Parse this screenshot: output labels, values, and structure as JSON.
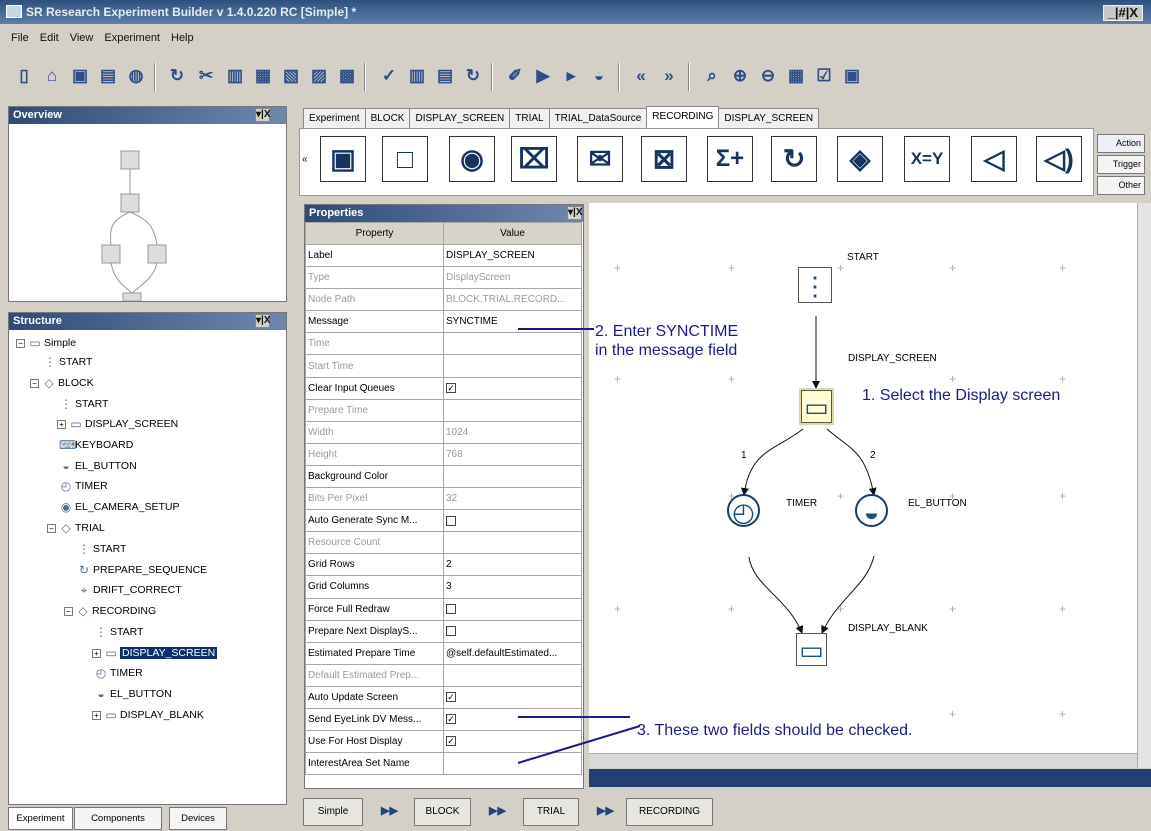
{
  "window": {
    "title": "SR Research Experiment Builder v 1.4.0.220 RC [Simple] *",
    "controls": "_|#|X"
  },
  "menu": [
    "File",
    "Edit",
    "View",
    "Experiment",
    "Help"
  ],
  "toolbar_icons": [
    "new-file-icon",
    "open-folder-icon",
    "save-icon",
    "print-icon",
    "cube-icon",
    "redo-icon",
    "cut-icon",
    "copy-icon",
    "paste-icon",
    "delete-icon",
    "clear-icon",
    "grid-icon",
    "check-icon",
    "chart-icon",
    "note-icon",
    "refresh-icon",
    "brush-icon",
    "run-icon",
    "play-icon",
    "hat-icon",
    "rewind-icon",
    "forward-icon",
    "search-icon",
    "zoom-in-icon",
    "zoom-out-icon",
    "layout-icon",
    "checkbox-icon",
    "settings-icon"
  ],
  "overview": {
    "title": "Overview",
    "controls": "▾|X"
  },
  "structure": {
    "title": "Structure",
    "controls": "▾|X",
    "root": "Simple",
    "items": [
      {
        "label": "START",
        "icon": "traffic-light-icon"
      },
      {
        "label": "BLOCK",
        "icon": "diamond-node-icon"
      },
      {
        "label": "START",
        "icon": "traffic-light-icon"
      },
      {
        "label": "DISPLAY_SCREEN",
        "icon": "monitor-icon"
      },
      {
        "label": "KEYBOARD",
        "icon": "keyboard-icon"
      },
      {
        "label": "EL_BUTTON",
        "icon": "gamepad-icon"
      },
      {
        "label": "TIMER",
        "icon": "timer-icon"
      },
      {
        "label": "EL_CAMERA_SETUP",
        "icon": "eye-camera-icon"
      },
      {
        "label": "TRIAL",
        "icon": "diamond-node-icon"
      },
      {
        "label": "START",
        "icon": "traffic-light-icon"
      },
      {
        "label": "PREPARE_SEQUENCE",
        "icon": "refresh-icon"
      },
      {
        "label": "DRIFT_CORRECT",
        "icon": "target-icon"
      },
      {
        "label": "RECORDING",
        "icon": "diamond-node-icon"
      },
      {
        "label": "START",
        "icon": "traffic-light-icon"
      },
      {
        "label": "DISPLAY_SCREEN",
        "icon": "monitor-icon"
      },
      {
        "label": "TIMER",
        "icon": "timer-icon"
      },
      {
        "label": "EL_BUTTON",
        "icon": "gamepad-icon"
      },
      {
        "label": "DISPLAY_BLANK",
        "icon": "monitor-icon"
      }
    ]
  },
  "editor_tabs": [
    "Experiment",
    "BLOCK",
    "DISPLAY_SCREEN",
    "TRIAL",
    "TRIAL_DataSource",
    "RECORDING",
    "DISPLAY_SCREEN"
  ],
  "palette": {
    "categories": [
      "Action",
      "Trigger",
      "Other"
    ],
    "items": [
      "display-screen-icon",
      "display-blank-icon",
      "eye-camera-icon",
      "mouse-icon",
      "send-message-icon",
      "error-message-icon",
      "sum-icon",
      "rotate-icon",
      "decision-icon",
      "assignment-icon",
      "sound-icon",
      "sound-volume-icon"
    ]
  },
  "properties": {
    "title": "Properties",
    "controls": "▾|X",
    "headers": {
      "property": "Property",
      "value": "Value"
    },
    "rows": [
      {
        "name": "Label",
        "value": "DISPLAY_SCREEN",
        "disabled": false
      },
      {
        "name": "Type",
        "value": "DisplayScreen",
        "disabled": true
      },
      {
        "name": "Node Path",
        "value": "BLOCK.TRIAL.RECORD...",
        "disabled": true
      },
      {
        "name": "Message",
        "value": "SYNCTIME",
        "disabled": false
      },
      {
        "name": "Time",
        "value": "",
        "disabled": true
      },
      {
        "name": "Start Time",
        "value": "",
        "disabled": true
      },
      {
        "name": "Clear Input Queues",
        "value": "",
        "checked": true,
        "disabled": false
      },
      {
        "name": "Prepare Time",
        "value": "",
        "disabled": true
      },
      {
        "name": "Width",
        "value": "1024",
        "disabled": true
      },
      {
        "name": "Height",
        "value": "768",
        "disabled": true
      },
      {
        "name": "Background Color",
        "value": "",
        "disabled": false
      },
      {
        "name": "Bits Per Pixel",
        "value": "32",
        "disabled": true
      },
      {
        "name": "Auto Generate Sync M...",
        "value": "",
        "checked": false,
        "disabled": false
      },
      {
        "name": "Resource Count",
        "value": "",
        "disabled": true
      },
      {
        "name": "Grid Rows",
        "value": "2",
        "disabled": false
      },
      {
        "name": "Grid Columns",
        "value": "3",
        "disabled": false
      },
      {
        "name": "Force Full Redraw",
        "value": "",
        "checked": false,
        "disabled": false
      },
      {
        "name": "Prepare Next DisplayS...",
        "value": "",
        "checked": false,
        "disabled": false
      },
      {
        "name": "Estimated Prepare Time",
        "value": "@self.defaultEstimated...",
        "disabled": false
      },
      {
        "name": "Default Estimated Prep...",
        "value": "",
        "disabled": true
      },
      {
        "name": "Auto Update Screen",
        "value": "",
        "checked": true,
        "disabled": false
      },
      {
        "name": "Send EyeLink DV Mess...",
        "value": "",
        "checked": true,
        "disabled": false
      },
      {
        "name": "Use For Host Display",
        "value": "",
        "checked": true,
        "disabled": false
      },
      {
        "name": "InterestArea Set Name",
        "value": "",
        "disabled": false
      }
    ]
  },
  "flow": {
    "nodes": [
      {
        "label": "START",
        "icon": "traffic-light-icon"
      },
      {
        "label": "DISPLAY_SCREEN",
        "icon": "monitor-icon"
      },
      {
        "label": "TIMER",
        "icon": "timer-icon"
      },
      {
        "label": "EL_BUTTON",
        "icon": "gamepad-icon"
      },
      {
        "label": "DISPLAY_BLANK",
        "icon": "monitor-icon"
      }
    ],
    "edge_labels": [
      "1",
      "2"
    ]
  },
  "annotations": [
    "2. Enter SYNCTIME\nin the message field",
    "1. Select the Display screen",
    "3. These two fields should be checked."
  ],
  "breadcrumbs": [
    "Simple",
    "BLOCK",
    "TRIAL",
    "RECORDING"
  ],
  "bottom_tabs": [
    "Experiment",
    "Components",
    "Devices"
  ]
}
